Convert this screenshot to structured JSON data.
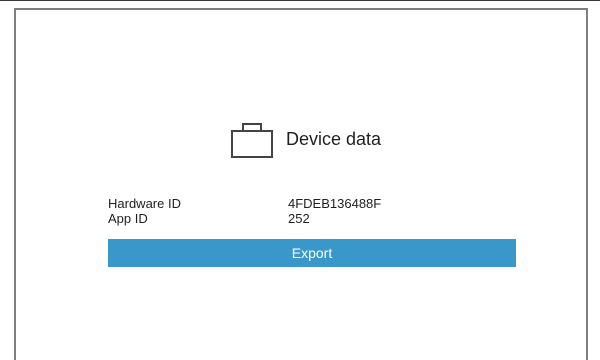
{
  "device_panel": {
    "title": "Device data",
    "icon": "briefcase-icon",
    "fields": [
      {
        "label": "Hardware ID",
        "value": "4FDEB136488F"
      },
      {
        "label": "App ID",
        "value": "252"
      }
    ],
    "export_label": "Export"
  },
  "colors": {
    "accent": "#3a97ca",
    "border": "#7f7f7f",
    "background": "#ffffff"
  }
}
